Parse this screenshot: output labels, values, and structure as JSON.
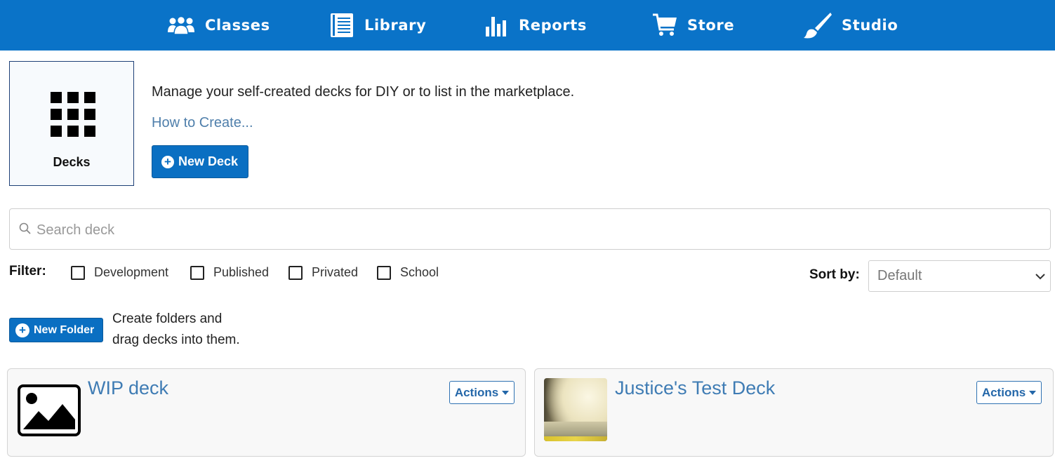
{
  "nav": {
    "items": [
      {
        "label": "Classes",
        "icon": "users-icon"
      },
      {
        "label": "Library",
        "icon": "book-icon"
      },
      {
        "label": "Reports",
        "icon": "bar-chart-icon"
      },
      {
        "label": "Store",
        "icon": "cart-icon"
      },
      {
        "label": "Studio",
        "icon": "paintbrush-icon"
      }
    ],
    "background": "#0a73c8"
  },
  "decks_tile": {
    "label": "Decks",
    "icon": "grid-icon"
  },
  "intro": {
    "description": "Manage your self-created decks for DIY or to list in the marketplace.",
    "how_to_link": "How to Create...",
    "new_deck_button": "New Deck"
  },
  "search": {
    "placeholder": "Search deck",
    "value": ""
  },
  "filter": {
    "label": "Filter:",
    "options": [
      {
        "label": "Development",
        "checked": false
      },
      {
        "label": "Published",
        "checked": false
      },
      {
        "label": "Privated",
        "checked": false
      },
      {
        "label": "School",
        "checked": false
      }
    ]
  },
  "sort": {
    "label": "Sort by:",
    "selected": "Default"
  },
  "folder": {
    "new_folder_button": "New Folder",
    "hint_line1": "Create folders and",
    "hint_line2": "drag decks into them."
  },
  "decks": [
    {
      "title": "WIP deck",
      "actions_label": "Actions",
      "thumbnail": "image-placeholder-icon"
    },
    {
      "title": "Justice's Test Deck",
      "actions_label": "Actions",
      "thumbnail": "photo"
    }
  ],
  "colors": {
    "primary": "#0a6fc2",
    "link": "#3f7cb4"
  }
}
